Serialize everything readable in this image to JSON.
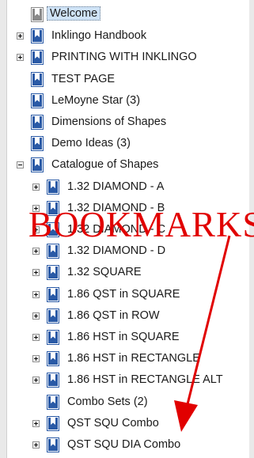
{
  "bookmarks": {
    "items": [
      {
        "label": "Welcome",
        "level": 0,
        "expander": "none",
        "selected": true,
        "icon": "bookmark-grey-icon"
      },
      {
        "label": "Inklingo Handbook",
        "level": 0,
        "expander": "plus",
        "icon": "bookmark-icon"
      },
      {
        "label": "PRINTING WITH INKLINGO",
        "level": 0,
        "expander": "plus",
        "icon": "bookmark-icon"
      },
      {
        "label": "TEST PAGE",
        "level": 0,
        "expander": "none",
        "icon": "bookmark-icon"
      },
      {
        "label": "LeMoyne Star (3)",
        "level": 0,
        "expander": "none",
        "icon": "bookmark-icon"
      },
      {
        "label": "Dimensions of Shapes",
        "level": 0,
        "expander": "none",
        "icon": "bookmark-icon"
      },
      {
        "label": "Demo Ideas (3)",
        "level": 0,
        "expander": "none",
        "icon": "bookmark-icon"
      },
      {
        "label": "Catalogue of Shapes",
        "level": 0,
        "expander": "minus",
        "icon": "bookmark-icon"
      },
      {
        "label": "1.32 DIAMOND - A",
        "level": 1,
        "expander": "plus",
        "icon": "bookmark-icon"
      },
      {
        "label": "1.32 DIAMOND - B",
        "level": 1,
        "expander": "plus",
        "icon": "bookmark-icon"
      },
      {
        "label": "1.32 DIAMOND - C",
        "level": 1,
        "expander": "plus",
        "icon": "bookmark-icon"
      },
      {
        "label": "1.32 DIAMOND - D",
        "level": 1,
        "expander": "plus",
        "icon": "bookmark-icon"
      },
      {
        "label": "1.32 SQUARE",
        "level": 1,
        "expander": "plus",
        "icon": "bookmark-icon"
      },
      {
        "label": "1.86 QST in SQUARE",
        "level": 1,
        "expander": "plus",
        "icon": "bookmark-icon"
      },
      {
        "label": "1.86 QST in ROW",
        "level": 1,
        "expander": "plus",
        "icon": "bookmark-icon"
      },
      {
        "label": "1.86 HST in SQUARE",
        "level": 1,
        "expander": "plus",
        "icon": "bookmark-icon"
      },
      {
        "label": "1.86 HST in RECTANGLE",
        "level": 1,
        "expander": "plus",
        "icon": "bookmark-icon"
      },
      {
        "label": "1.86 HST in RECTANGLE ALT",
        "level": 1,
        "expander": "plus",
        "icon": "bookmark-icon"
      },
      {
        "label": "Combo Sets (2)",
        "level": 1,
        "expander": "none",
        "icon": "bookmark-icon"
      },
      {
        "label": "QST SQU Combo",
        "level": 1,
        "expander": "plus",
        "icon": "bookmark-icon"
      },
      {
        "label": "QST SQU DIA Combo",
        "level": 1,
        "expander": "plus",
        "icon": "bookmark-icon"
      }
    ]
  },
  "annotation": {
    "text": "BOOKMARKS",
    "color": "#e10000"
  },
  "colors": {
    "bookmark_blue": "#2a5aa6",
    "bookmark_grey": "#8a8a8a",
    "selection": "#cfe3f7"
  }
}
